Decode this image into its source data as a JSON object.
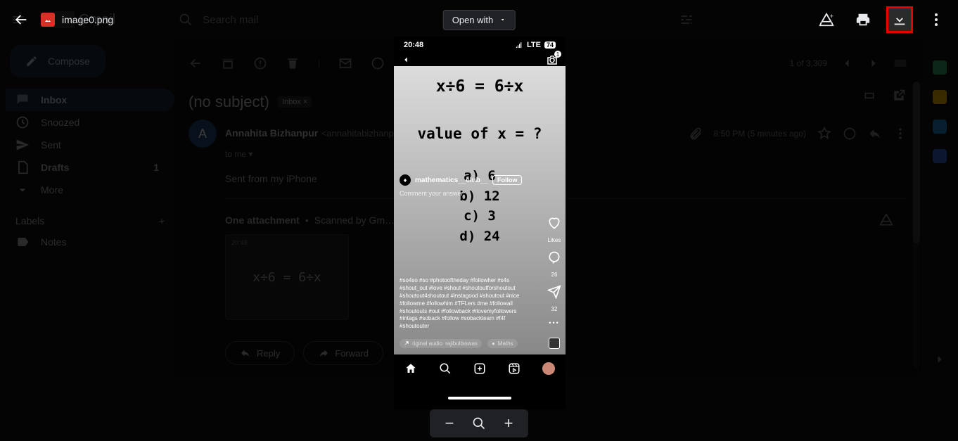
{
  "gmail": {
    "brand": "Gmail",
    "search_placeholder": "Search mail",
    "compose": "Compose",
    "nav": {
      "inbox": "Inbox",
      "snoozed": "Snoozed",
      "sent": "Sent",
      "drafts": "Drafts",
      "drafts_count": "1",
      "more": "More"
    },
    "labels_header": "Labels",
    "label_notes": "Notes",
    "pager": "1 of 3,309",
    "subject": "(no subject)",
    "subject_chip": "Inbox ×",
    "sender_name": "Annahita Bizhanpur",
    "sender_email": "<annahitabizhanp…",
    "to_line": "to me",
    "timestamp": "8:50 PM (5 minutes ago)",
    "body_text": "Sent from my iPhone",
    "attachments_hdr": "One attachment",
    "scanned": "Scanned by Gm…",
    "thumb_eq": "x÷6 = 6÷x",
    "thumb_time": "20:48",
    "reply": "Reply",
    "forward": "Forward",
    "avatar_letter": "A"
  },
  "preview": {
    "filename": "image0.png",
    "open_with": "Open with"
  },
  "instagram": {
    "status_time": "20:48",
    "status_net": "LTE",
    "status_batt": "74",
    "equation": "x÷6 = 6÷x",
    "question": "value of x = ?",
    "opt_a": "a) 6",
    "opt_b": "b) 12",
    "opt_c": "c) 3",
    "opt_d": "d) 24",
    "author": "mathematics__club__",
    "follow": "Follow",
    "comment_prompt": "Comment your answer",
    "likes_label": "Likes",
    "comments_count": "26",
    "shares_count": "32",
    "hashtags": "#so4so #so #photooftheday #followher #s4s #shout_out #love #shout #shoutoutforshoutout #shoutout4shoutout #instagood #shoutout #nice #followme #followhim #TFLers #me #followall #shoutouts #out #followback #ilovemyfollowers #intags #soback #follow #sobackteam #f4f #shoutouter",
    "audio_original": "riginal audio",
    "audio_user": "rajibulbiswas",
    "topic": "Maths"
  },
  "highlight": {
    "target": "download-button"
  }
}
